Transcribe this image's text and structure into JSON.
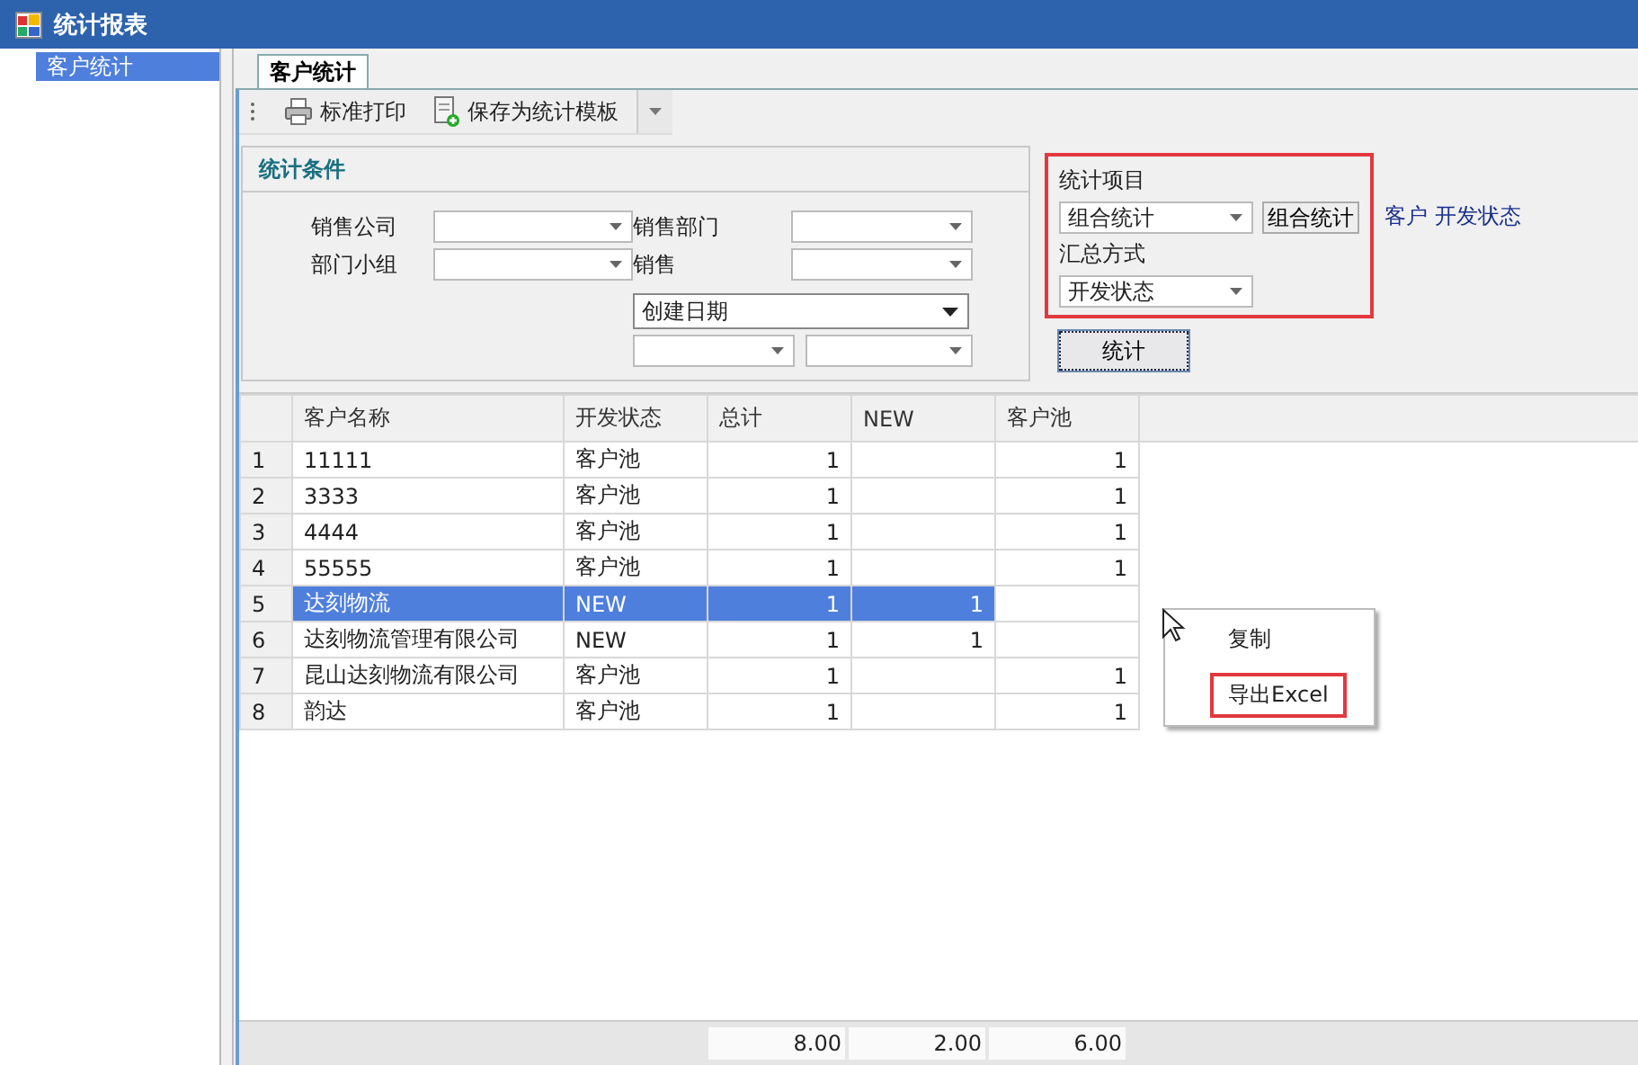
{
  "window": {
    "title": "统计报表"
  },
  "sidebar": {
    "items": [
      {
        "label": "客户统计",
        "selected": true
      }
    ]
  },
  "tabs": [
    {
      "label": "客户统计",
      "selected": true
    }
  ],
  "toolbar": {
    "buttons": [
      {
        "label": "标准打印",
        "kind": "print"
      },
      {
        "label": "保存为统计模板",
        "kind": "save"
      }
    ]
  },
  "conditions": {
    "title": "统计条件",
    "fields": [
      {
        "label": "销售公司"
      },
      {
        "label": "销售部门"
      },
      {
        "label": "部门小组"
      },
      {
        "label": "销售"
      }
    ],
    "date_field": {
      "value": "创建日期"
    }
  },
  "statistics": {
    "annotated": true,
    "item_label": "统计项目",
    "item_value": "组合统计",
    "item_button": "组合统计",
    "combination": "客户 开发状态",
    "summary_label": "汇总方式",
    "summary_value": "开发状态",
    "run_button": "统计"
  },
  "table": {
    "columns": [
      "客户名称",
      "开发状态",
      "总计",
      "NEW",
      "客户池"
    ],
    "rows": [
      {
        "number": "1",
        "cells": [
          "11111",
          "客户池",
          "1",
          null,
          "1"
        ],
        "selected": false
      },
      {
        "number": "2",
        "cells": [
          "3333",
          "客户池",
          "1",
          null,
          "1"
        ],
        "selected": false
      },
      {
        "number": "3",
        "cells": [
          "4444",
          "客户池",
          "1",
          null,
          "1"
        ],
        "selected": false
      },
      {
        "number": "4",
        "cells": [
          "55555",
          "客户池",
          "1",
          null,
          "1"
        ],
        "selected": false
      },
      {
        "number": "5",
        "cells": [
          "达刻物流",
          "NEW",
          "1",
          "1",
          null
        ],
        "selected": true
      },
      {
        "number": "6",
        "cells": [
          "达刻物流管理有限公司",
          "NEW",
          "1",
          "1",
          null
        ],
        "selected": false
      },
      {
        "number": "7",
        "cells": [
          "昆山达刻物流有限公司",
          "客户池",
          "1",
          null,
          "1"
        ],
        "selected": false
      },
      {
        "number": "8",
        "cells": [
          "韵达",
          "客户池",
          "1",
          null,
          "1"
        ],
        "selected": false
      }
    ],
    "totals": [
      "8.00",
      "2.00",
      "6.00"
    ]
  },
  "context_menu": {
    "items": [
      {
        "label": "复制",
        "annotated": false
      },
      {
        "label": "导出Excel",
        "annotated": true
      }
    ]
  }
}
